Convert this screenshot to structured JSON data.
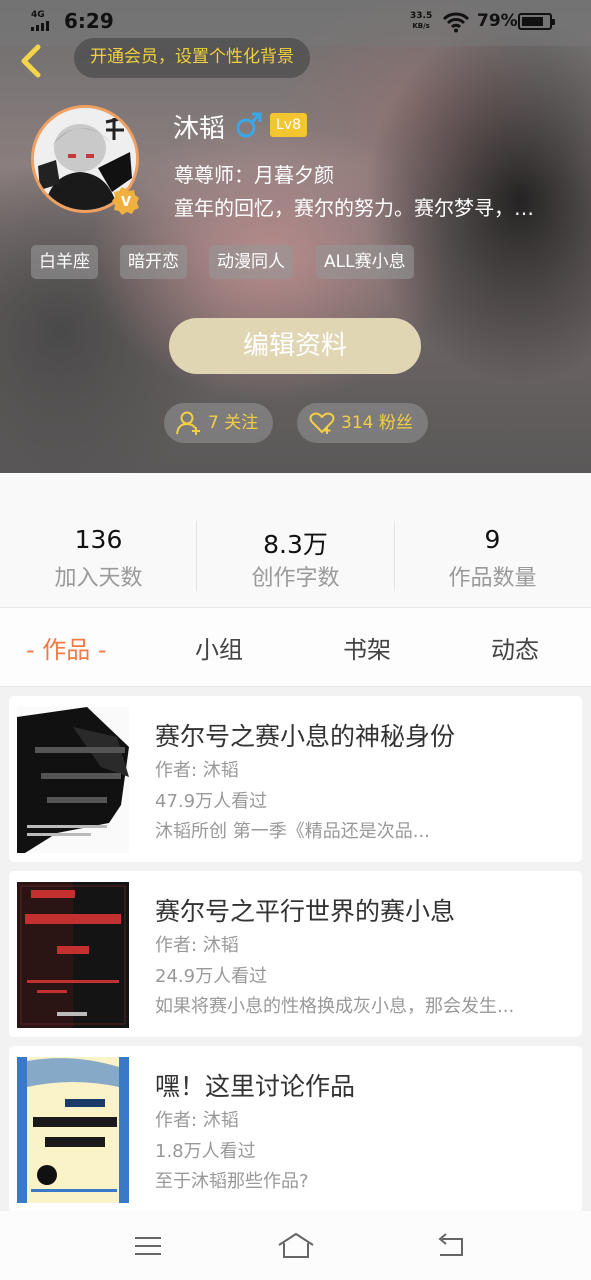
{
  "status_bar": {
    "network": "4G",
    "time": "6:29",
    "speed_value": "33.5",
    "speed_unit": "KB/s",
    "battery_pct": "79%",
    "battery_level": 0.79
  },
  "header": {
    "vip_banner": "开通会员，设置个性化背景",
    "username": "沐韬",
    "gender": "♂",
    "level": "Lv8",
    "mentor": "尊尊师：月暮夕颜",
    "bio": "童年的回忆，赛尔的努力。赛尔梦寻，…",
    "tags": [
      "白羊座",
      "暗开恋",
      "动漫同人",
      "ALL赛小息"
    ],
    "edit_button": "编辑资料",
    "following": "7 关注",
    "followers": "314 粉丝",
    "accent_color": "#f3cf45"
  },
  "stats": [
    {
      "value": "136",
      "label": "加入天数"
    },
    {
      "value": "8.3万",
      "label": "创作字数"
    },
    {
      "value": "9",
      "label": "作品数量"
    }
  ],
  "tabs": [
    {
      "label": "- 作品 -",
      "active": true
    },
    {
      "label": "小组",
      "active": false
    },
    {
      "label": "书架",
      "active": false
    },
    {
      "label": "动态",
      "active": false
    }
  ],
  "works": [
    {
      "title": "赛尔号之赛小息的神秘身份",
      "author": "作者: 沐韬",
      "views": "47.9万人看过",
      "desc": "沐韬所创 第一季《精品还是次品..."
    },
    {
      "title": "赛尔号之平行世界的赛小息",
      "author": "作者: 沐韬",
      "views": "24.9万人看过",
      "desc": "如果将赛小息的性格换成灰小息，那会发生..."
    },
    {
      "title": "嘿！这里讨论作品",
      "author": "作者: 沐韬",
      "views": "1.8万人看过",
      "desc": "至于沐韬那些作品?"
    }
  ],
  "icons": {
    "back": "chevron-left-icon",
    "follow": "add-user-icon",
    "fans": "heart-icon",
    "nav_menu": "menu-icon",
    "nav_home": "home-icon",
    "nav_back": "return-icon"
  }
}
